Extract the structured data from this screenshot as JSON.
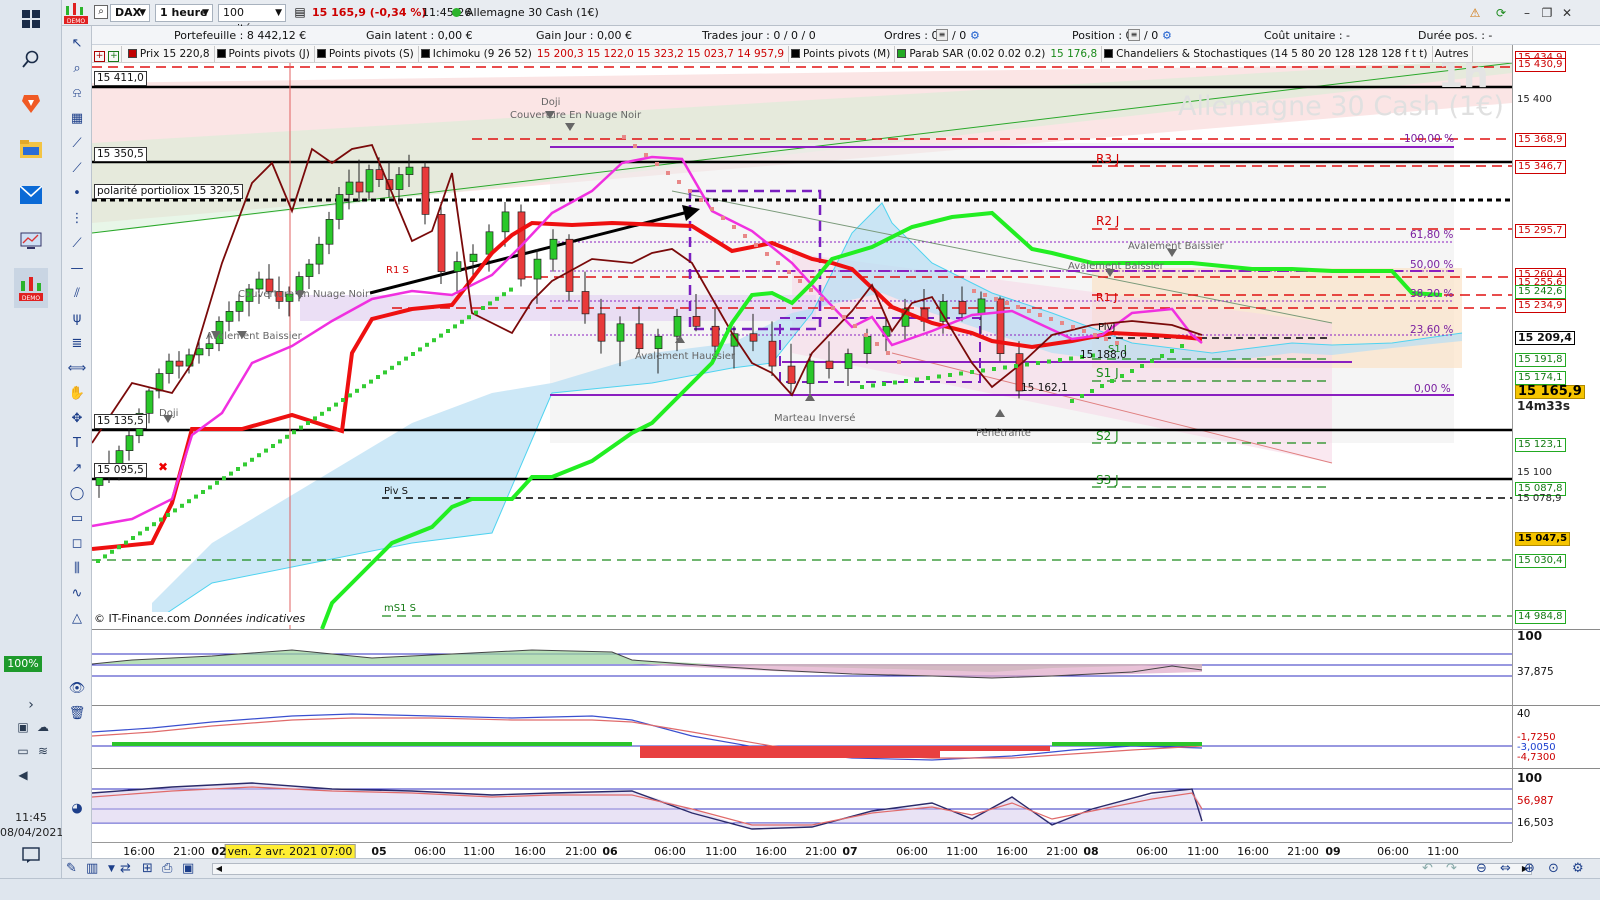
{
  "taskbar": {
    "clock_time": "11:45",
    "clock_date": "08/04/2021",
    "zoom_percent": "100%"
  },
  "toolbar": {
    "symbol": "DAX",
    "timeframe": "1 heure",
    "units": "100 unités",
    "price_change": "15 165,9 (-0,34 %)",
    "time": "11:45:26",
    "instrument": "Allemagne 30 Cash (1€)"
  },
  "stats": {
    "portefeuille": "Portefeuille : 8 442,12 €",
    "gain_latent": "Gain latent : 0,00 €",
    "gain_jour": "Gain Jour : 0,00 €",
    "trades_jour": "Trades jour : 0 / 0 / 0",
    "ordres": "Ordres : 0",
    "ordres_b": "/ 0",
    "ordres_c": "/ 0",
    "position": "Position : 0",
    "position_b": "/ 0",
    "cout_unitaire": "Coût unitaire : -",
    "duree_pos": "Durée pos. : -"
  },
  "indicators": [
    {
      "label": "Prix 15 220,8",
      "color": "#c00000",
      "extra": ""
    },
    {
      "label": "Points pivots (J)",
      "color": "#000000",
      "extra": ""
    },
    {
      "label": "Points pivots (S)",
      "color": "#000000",
      "extra": ""
    },
    {
      "label": "Ichimoku (9 26 52)",
      "color": "#000000",
      "extra": "15 200,3  15 122,0  15 323,2  15 023,7  14 957,9"
    },
    {
      "label": "Points pivots (M)",
      "color": "#000000",
      "extra": ""
    },
    {
      "label": "Parab SAR (0.02 0.02 0.2)",
      "color": "#22aa22",
      "extra": "15 176,8"
    },
    {
      "label": "Chandeliers & Stochastiques (14 5 80 20 128 128 128 f t t)",
      "color": "#000000",
      "extra": ""
    },
    {
      "label": "Autres",
      "color": "",
      "extra": ""
    }
  ],
  "chart": {
    "watermark_title": "Allemagne 30 Cash (1€)",
    "watermark_tf": "1h",
    "copyright": "© IT-Finance.com",
    "copyright_note": "Données indicatives",
    "level_labels": {
      "l15411": "15 411,0",
      "l15350": "15 350,5",
      "l15320": "polarité portioliox 15 320,5",
      "l15135": "15 135,5",
      "l15095": "15 095,5"
    },
    "pivot_labels": {
      "r3": "R3 J",
      "r2": "R2 J",
      "s1": "S1 J",
      "s2": "S2 J",
      "s3": "S3 J",
      "rs1": "R1 S",
      "piv_s": "Piv S",
      "ms1": "mS1 S",
      "pivj": "PivJ",
      "r1j": "R1 J",
      "s1jb": "S1 J"
    },
    "fib_labels": {
      "f100": "100,00 %",
      "f618": "61,80 %",
      "f50": "50,00 %",
      "f382": "38,20 %",
      "f236": "23,60 %",
      "f0": "0,00 %"
    },
    "pattern_labels": {
      "doji1": "Doji",
      "couverture1": "Couverture En Nuage Noir",
      "couverture2": "Couverture En Nuage Noir",
      "avalement_baissier1": "Avalement Baissier",
      "avalement_haussier": "Avalement Haussier",
      "marteau": "Marteau Inversé",
      "penetrante": "Pénétrante",
      "avalement_baissier2": "Avalement Baissier",
      "avalement_baissier3": "Avalement Baissier",
      "doji2": "Doji"
    },
    "value_labels": {
      "v1": "15 188,0",
      "v2": "15 162,1"
    }
  },
  "price_axis": [
    {
      "text": "15 434,9",
      "style": "red",
      "price": 15434.9
    },
    {
      "text": "15 430,9",
      "style": "red",
      "price": 15429.0
    },
    {
      "text": "15 400",
      "style": "plain",
      "price": 15400
    },
    {
      "text": "15 368,9",
      "style": "red",
      "price": 15368.9
    },
    {
      "text": "15 346,7",
      "style": "red",
      "price": 15346.7
    },
    {
      "text": "15 295,7",
      "style": "red",
      "price": 15295.7
    },
    {
      "text": "15 260,4",
      "style": "red",
      "price": 15260.4
    },
    {
      "text": "15 255,6",
      "style": "red",
      "price": 15253.6
    },
    {
      "text": "15 242,6",
      "style": "green",
      "price": 15246.6
    },
    {
      "text": "15 234,9",
      "style": "red",
      "price": 15234.9
    },
    {
      "text": "15 209,4",
      "style": "bold",
      "price": 15209.4
    },
    {
      "text": "15 191,8",
      "style": "green",
      "price": 15191.8
    },
    {
      "text": "15 174,1",
      "style": "green",
      "price": 15177.1
    },
    {
      "text": "15 165,9",
      "style": "yel",
      "price": 15165.9
    },
    {
      "text": "14m33s",
      "style": "plainbold",
      "price": 15154.0
    },
    {
      "text": "15 123,1",
      "style": "green",
      "price": 15123.1
    },
    {
      "text": "15 100",
      "style": "plain",
      "price": 15100
    },
    {
      "text": "15 087,8",
      "style": "green",
      "price": 15087.8
    },
    {
      "text": "15 078,9",
      "style": "plain",
      "price": 15078.9
    },
    {
      "text": "15 047,5",
      "style": "yel",
      "price": 15047.5
    },
    {
      "text": "15 030,4",
      "style": "green",
      "price": 15030.4
    },
    {
      "text": "14 984,8",
      "style": "green",
      "price": 14984.8
    }
  ],
  "panels": {
    "p1": {
      "top": "100",
      "mid": "37,875"
    },
    "p2": {
      "top": "40",
      "v1": "-1,7250",
      "v2": "-3,0050",
      "v3": "-4,7300"
    },
    "p3": {
      "top": "100",
      "v1": "56,987",
      "v2": "16,503"
    }
  },
  "time_axis": {
    "labels": [
      {
        "t": "16:00",
        "day": false
      },
      {
        "t": "21:00",
        "day": false
      },
      {
        "t": "02",
        "day": true
      },
      {
        "t": "05",
        "day": true
      },
      {
        "t": "06:00",
        "day": false
      },
      {
        "t": "11:00",
        "day": false
      },
      {
        "t": "16:00",
        "day": false
      },
      {
        "t": "21:00",
        "day": false
      },
      {
        "t": "06",
        "day": true
      },
      {
        "t": "06:00",
        "day": false
      },
      {
        "t": "11:00",
        "day": false
      },
      {
        "t": "16:00",
        "day": false
      },
      {
        "t": "21:00",
        "day": false
      },
      {
        "t": "07",
        "day": true
      },
      {
        "t": "06:00",
        "day": false
      },
      {
        "t": "11:00",
        "day": false
      },
      {
        "t": "16:00",
        "day": false
      },
      {
        "t": "21:00",
        "day": false
      },
      {
        "t": "08",
        "day": true
      },
      {
        "t": "06:00",
        "day": false
      },
      {
        "t": "11:00",
        "day": false
      },
      {
        "t": "16:00",
        "day": false
      },
      {
        "t": "21:00",
        "day": false
      },
      {
        "t": "09",
        "day": true
      },
      {
        "t": "06:00",
        "day": false
      },
      {
        "t": "11:00",
        "day": false
      }
    ],
    "cursor_date": "ven. 2 avr. 2021 07:00"
  },
  "candles": [
    [
      15090,
      15108,
      15080,
      15104
    ],
    [
      15104,
      15118,
      15092,
      15098
    ],
    [
      15098,
      15122,
      15094,
      15118
    ],
    [
      15118,
      15140,
      15110,
      15130
    ],
    [
      15130,
      15152,
      15124,
      15148
    ],
    [
      15148,
      15168,
      15140,
      15166
    ],
    [
      15166,
      15184,
      15160,
      15180
    ],
    [
      15180,
      15196,
      15172,
      15190
    ],
    [
      15190,
      15198,
      15176,
      15186
    ],
    [
      15186,
      15200,
      15180,
      15195
    ],
    [
      15195,
      15208,
      15188,
      15200
    ],
    [
      15200,
      15212,
      15194,
      15204
    ],
    [
      15204,
      15226,
      15198,
      15222
    ],
    [
      15222,
      15238,
      15214,
      15230
    ],
    [
      15230,
      15244,
      15222,
      15238
    ],
    [
      15238,
      15252,
      15226,
      15248
    ],
    [
      15248,
      15262,
      15236,
      15256
    ],
    [
      15256,
      15268,
      15240,
      15246
    ],
    [
      15246,
      15258,
      15232,
      15238
    ],
    [
      15238,
      15250,
      15226,
      15244
    ],
    [
      15244,
      15262,
      15238,
      15258
    ],
    [
      15258,
      15272,
      15248,
      15268
    ],
    [
      15268,
      15290,
      15260,
      15284
    ],
    [
      15284,
      15310,
      15276,
      15304
    ],
    [
      15304,
      15330,
      15296,
      15324
    ],
    [
      15324,
      15344,
      15312,
      15334
    ],
    [
      15334,
      15352,
      15318,
      15326
    ],
    [
      15326,
      15348,
      15320,
      15344
    ],
    [
      15344,
      15354,
      15330,
      15336
    ],
    [
      15336,
      15350,
      15322,
      15328
    ],
    [
      15328,
      15346,
      15316,
      15340
    ],
    [
      15340,
      15356,
      15330,
      15346
    ],
    [
      15346,
      15350,
      15300,
      15308
    ],
    [
      15308,
      15318,
      15252,
      15262
    ],
    [
      15262,
      15278,
      15244,
      15270
    ],
    [
      15270,
      15284,
      15256,
      15276
    ],
    [
      15276,
      15300,
      15262,
      15294
    ],
    [
      15294,
      15318,
      15282,
      15310
    ],
    [
      15310,
      15316,
      15250,
      15256
    ],
    [
      15256,
      15280,
      15236,
      15272
    ],
    [
      15272,
      15296,
      15262,
      15288
    ],
    [
      15288,
      15292,
      15238,
      15246
    ],
    [
      15246,
      15262,
      15220,
      15228
    ],
    [
      15228,
      15240,
      15196,
      15206
    ],
    [
      15206,
      15226,
      15186,
      15220
    ],
    [
      15220,
      15234,
      15196,
      15200
    ],
    [
      15200,
      15216,
      15180,
      15210
    ],
    [
      15210,
      15232,
      15198,
      15226
    ],
    [
      15226,
      15244,
      15214,
      15218
    ],
    [
      15218,
      15232,
      15196,
      15202
    ],
    [
      15202,
      15218,
      15184,
      15212
    ],
    [
      15212,
      15228,
      15198,
      15206
    ],
    [
      15206,
      15222,
      15178,
      15186
    ],
    [
      15186,
      15204,
      15162,
      15172
    ],
    [
      15172,
      15196,
      15162,
      15190
    ],
    [
      15190,
      15206,
      15176,
      15184
    ],
    [
      15184,
      15200,
      15170,
      15196
    ],
    [
      15196,
      15216,
      15188,
      15210
    ],
    [
      15210,
      15226,
      15198,
      15218
    ],
    [
      15218,
      15240,
      15206,
      15232
    ],
    [
      15232,
      15248,
      15214,
      15222
    ],
    [
      15222,
      15244,
      15212,
      15238
    ],
    [
      15238,
      15250,
      15222,
      15228
    ],
    [
      15228,
      15246,
      15212,
      15240
    ],
    [
      15240,
      15242,
      15190,
      15196
    ],
    [
      15196,
      15206,
      15160,
      15166
    ]
  ]
}
